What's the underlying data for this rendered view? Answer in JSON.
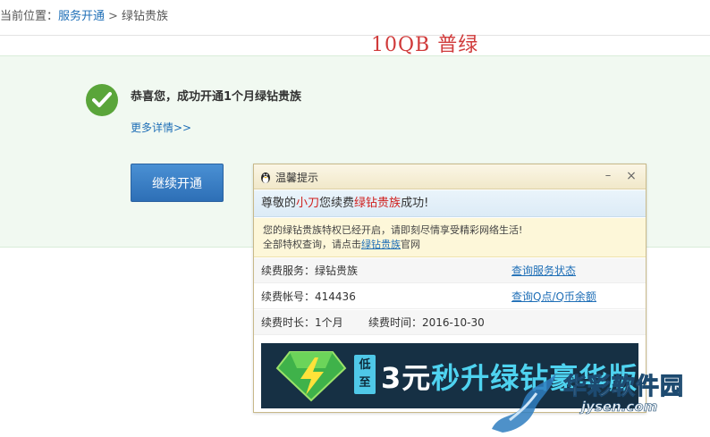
{
  "breadcrumb": {
    "prefix": "当前位置：",
    "link": "服务开通",
    "separator": ">",
    "current": "绿钻贵族"
  },
  "annotation": "10QB  普绿",
  "success": {
    "title": "恭喜您，成功开通1个月绿钻贵族",
    "more_link": "更多详情>>",
    "continue_button": "继续开通"
  },
  "popup": {
    "title": "温馨提示",
    "minimize": "–",
    "close": "×",
    "headline": {
      "part1": "尊敬的",
      "name": "小刀",
      "part2": "您续费",
      "service": "绿钻贵族",
      "part3": "成功!"
    },
    "notice": {
      "line1": "您的绿钻贵族特权已经开启，请即刻尽情享受精彩网络生活!",
      "line2_prefix": "全部特权查询，请点击",
      "line2_link": "绿钻贵族",
      "line2_suffix": "官网"
    },
    "rows": {
      "service_label": "续费服务：",
      "service_value": "绿钻贵族",
      "service_link": "查询服务状态",
      "account_label": "续费帐号：",
      "account_value": "414436",
      "account_link": "查询Q点/Q币余额",
      "duration_label": "续费时长：",
      "duration_value": "1个月",
      "time_label": "续费时间：",
      "time_value": "2016-10-30"
    },
    "banner": {
      "badge": "低至",
      "price": "3元",
      "slogan": "秒升绿钻豪华版"
    }
  },
  "watermark": {
    "text": "华彩软件园",
    "url": "jysen.com"
  },
  "colors": {
    "link": "#1f6fb7",
    "success_green": "#5aa53a",
    "highlight_red": "#d0201e",
    "panel_bg": "#f1f9f1"
  },
  "icons": {
    "success": "check-circle-icon",
    "popup": "qq-penguin-icon",
    "banner": "lightning-gem-icon"
  }
}
